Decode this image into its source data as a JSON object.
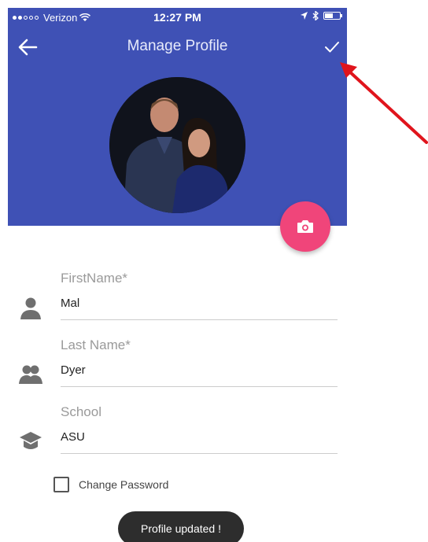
{
  "status": {
    "carrier": "Verizon",
    "time": "12:27 PM",
    "signal_bars": 2,
    "signal_total": 5,
    "battery_level": 0.55
  },
  "toolbar": {
    "title": "Manage Profile",
    "back_icon": "arrow-left-icon",
    "save_icon": "check-icon"
  },
  "avatar": {
    "icon": "profile-photo"
  },
  "camera_button": {
    "icon": "camera-icon",
    "color": "#f0457a"
  },
  "fields": {
    "first_name": {
      "label": "FirstName*",
      "value": "Mal",
      "icon": "person-icon"
    },
    "last_name": {
      "label": "Last Name*",
      "value": "Dyer",
      "icon": "people-icon"
    },
    "school": {
      "label": "School",
      "value": "ASU",
      "icon": "graduation-cap-icon"
    }
  },
  "change_password": {
    "label": "Change Password",
    "checked": false
  },
  "toast": {
    "text": "Profile updated !"
  },
  "colors": {
    "primary": "#3f51b5",
    "accent": "#f0457a",
    "annotation": "#e0141c"
  }
}
